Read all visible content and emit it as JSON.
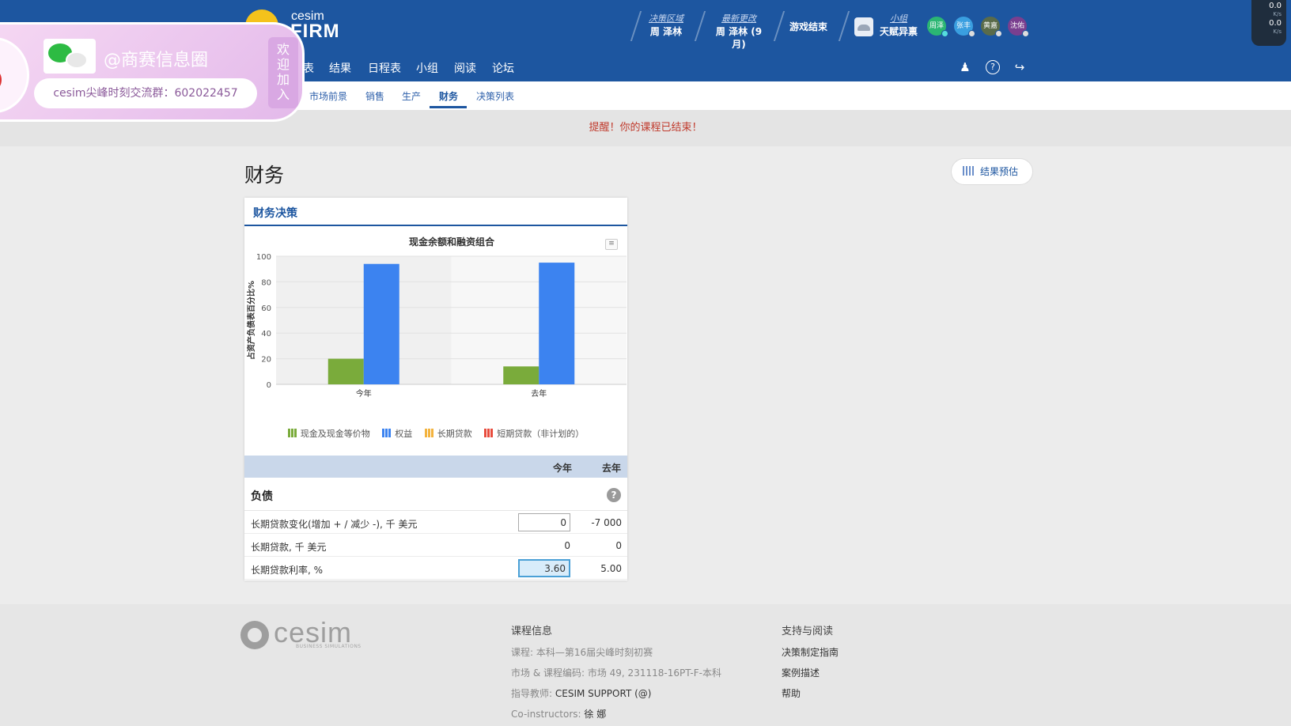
{
  "header": {
    "logo_small": "cesim",
    "logo_main": "FIRM",
    "decision_area_label": "决策区域",
    "decision_area_value": "周 泽林",
    "latest_change_label": "最新更改",
    "latest_change_value": "周 泽林 (9月)",
    "game_ended": "游戏结束",
    "team_label": "小组",
    "team_value": "天赋异禀",
    "avatars": [
      "周泽",
      "张丰",
      "黄嘉",
      "沈佑"
    ],
    "speed_up": "0.0",
    "speed_down": "0.0",
    "speed_unit": "K/s"
  },
  "nav": {
    "items": [
      "结果",
      "日程表",
      "小组",
      "阅读",
      "论坛"
    ],
    "partial": "表"
  },
  "subnav": {
    "tabs": [
      "市场前景",
      "销售",
      "生产",
      "财务",
      "决策列表"
    ],
    "active": "财务"
  },
  "alert": "提醒！你的课程已结束！",
  "page": {
    "title": "财务",
    "predict_button": "结果预估"
  },
  "card": {
    "title": "财务决策",
    "chart_menu": "≡"
  },
  "chart_data": {
    "type": "bar",
    "title": "现金余额和融资组合",
    "ylabel": "占资产负债表百分比%",
    "xlabel": "",
    "categories": [
      "今年",
      "去年"
    ],
    "ylim": [
      0,
      100
    ],
    "yticks": [
      "0",
      "20",
      "40",
      "60",
      "80",
      "100"
    ],
    "series": [
      {
        "name": "现金及现金等价物",
        "color": "#7aab3b",
        "values": [
          20,
          14
        ]
      },
      {
        "name": "权益",
        "color": "#3c83f0",
        "values": [
          94,
          95
        ]
      },
      {
        "name": "长期贷款",
        "color": "#f3b33e",
        "values": [
          0,
          0
        ]
      },
      {
        "name": "短期贷款（非计划的）",
        "color": "#e84c3d",
        "values": [
          0,
          0
        ]
      }
    ],
    "grid": true,
    "legend_position": "bottom"
  },
  "table": {
    "col_current": "今年",
    "col_previous": "去年",
    "section": "负债",
    "help": "?",
    "rows": [
      {
        "label": "长期贷款变化(增加 + / 减少 -), 千 美元",
        "current": "0",
        "previous": "-7 000"
      },
      {
        "label": "长期贷款, 千 美元",
        "current": "0",
        "previous": "0"
      },
      {
        "label": "长期贷款利率, %",
        "current": "3.60",
        "previous": "5.00"
      }
    ]
  },
  "footer": {
    "logo": "cesim",
    "logo_sub": "BUSINESS SIMULATIONS",
    "course_head": "课程信息",
    "course": "课程: 本科—第16届尖峰时刻初赛",
    "market_code": "市场 & 课程编码: 市场 49, 231118-16PT-F-本科",
    "instructor_label": "指导教师:",
    "instructor_value": "CESIM SUPPORT (@)",
    "coinstructor_label": "Co-instructors:",
    "coinstructor_value": "徐 娜",
    "support_head": "支持与阅读",
    "links": [
      "决策制定指南",
      "案例描述",
      "帮助"
    ]
  },
  "watermark": {
    "handle": "@商赛信息圈",
    "group": "cesim尖峰时刻交流群：602022457",
    "side": [
      "欢",
      "迎",
      "加",
      "入"
    ]
  }
}
